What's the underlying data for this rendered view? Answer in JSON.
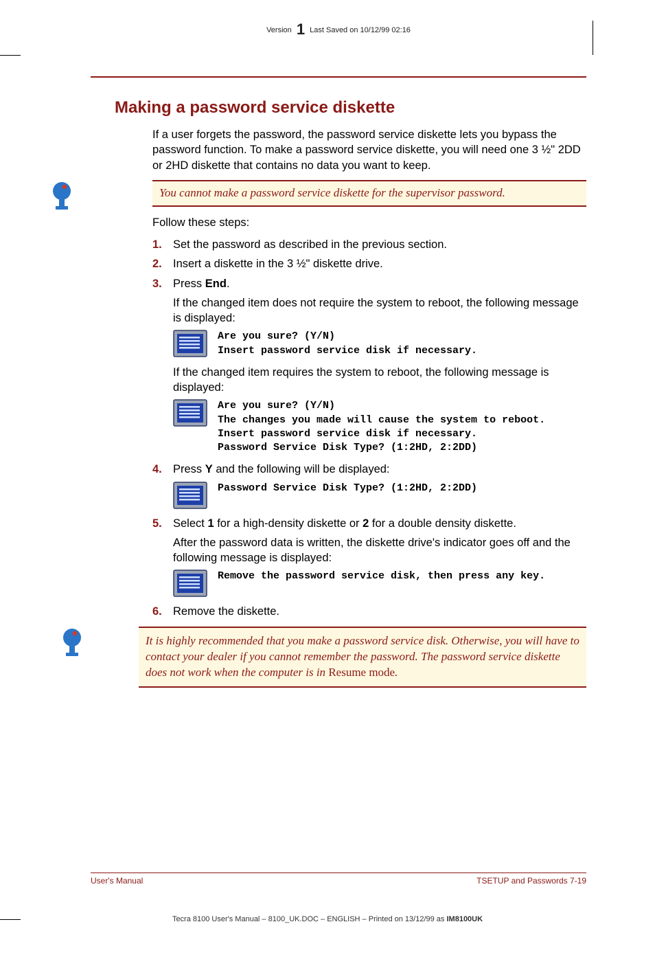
{
  "meta": {
    "version_prefix": "Version",
    "version_number": "1",
    "last_saved": "Last Saved on 10/12/99 02:16"
  },
  "section": {
    "title": "Making a password service diskette",
    "intro": "If a user forgets the password, the password service diskette lets you bypass the password function. To make a password service diskette, you will need one 3 ½\" 2DD or 2HD diskette that contains no data you want to keep."
  },
  "note1": "You cannot make a password service diskette for the supervisor password.",
  "follow": "Follow these steps:",
  "steps": {
    "s1_num": "1.",
    "s1": "Set the password as described in the previous section.",
    "s2_num": "2.",
    "s2": "Insert a diskette in the 3 ½\" diskette drive.",
    "s3_num": "3.",
    "s3_a": "Press ",
    "s3_b": "End",
    "s3_c": ".",
    "s3_p1": "If the changed item does not require the system to reboot, the following message is displayed:",
    "s3_scr1_l1": "Are you sure? (Y/N)",
    "s3_scr1_l2": "Insert password service disk if necessary.",
    "s3_p2": "If the changed item requires the system to reboot, the following message is displayed:",
    "s3_scr2_l1": "Are you sure? (Y/N)",
    "s3_scr2_l2": "The changes you made will cause the system to reboot.",
    "s3_scr2_l3": "Insert password service disk if necessary.",
    "s3_scr2_l4": "Password Service Disk Type? (1:2HD, 2:2DD)",
    "s4_num": "4.",
    "s4_a": "Press ",
    "s4_b": "Y",
    "s4_c": " and the following will be displayed:",
    "s4_scr_l1": "Password Service Disk Type? (1:2HD, 2:2DD)",
    "s5_num": "5.",
    "s5_a": "Select ",
    "s5_b": "1",
    "s5_c": " for a high-density diskette or ",
    "s5_d": "2",
    "s5_e": " for a double density diskette.",
    "s5_p1": "After the password data is written, the diskette drive's indicator goes off and the following message is displayed:",
    "s5_scr_l1": "Remove the password service disk, then press any key.",
    "s6_num": "6.",
    "s6": "Remove the diskette."
  },
  "note2_a": "It is highly recommended that you make a password service disk. Otherwise, you will have to contact your dealer if you cannot remember the password. The password service diskette does not work when the computer is in ",
  "note2_b": "Resume mode",
  "note2_c": ".",
  "footer": {
    "left": "User's Manual",
    "right": "TSETUP and Passwords  7-19",
    "meta_a": "Tecra 8100 User's Manual  – 8100_UK.DOC – ENGLISH – Printed on 13/12/99 as ",
    "meta_b": "IM8100UK"
  }
}
